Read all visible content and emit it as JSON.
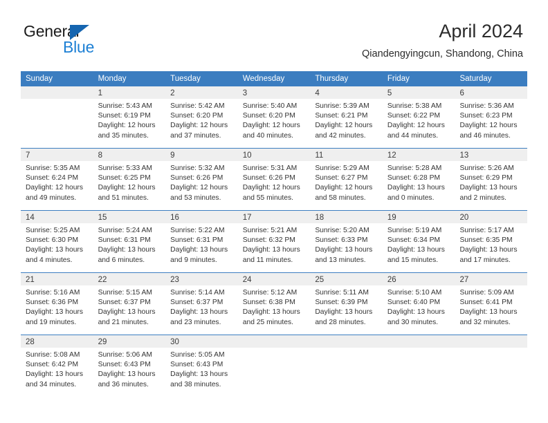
{
  "brand": {
    "name_dark": "General",
    "name_blue": "Blue",
    "accent_blue": "#1c7fd4",
    "triangle_blue": "#1565b0"
  },
  "header": {
    "title": "April 2024",
    "subtitle": "Qiandengyingcun, Shandong, China"
  },
  "calendar": {
    "header_bg": "#3b7dc0",
    "daynum_bg": "#efefef",
    "weekdays": [
      "Sunday",
      "Monday",
      "Tuesday",
      "Wednesday",
      "Thursday",
      "Friday",
      "Saturday"
    ],
    "weeks": [
      [
        {
          "day": "",
          "lines": []
        },
        {
          "day": "1",
          "lines": [
            "Sunrise: 5:43 AM",
            "Sunset: 6:19 PM",
            "Daylight: 12 hours",
            "and 35 minutes."
          ]
        },
        {
          "day": "2",
          "lines": [
            "Sunrise: 5:42 AM",
            "Sunset: 6:20 PM",
            "Daylight: 12 hours",
            "and 37 minutes."
          ]
        },
        {
          "day": "3",
          "lines": [
            "Sunrise: 5:40 AM",
            "Sunset: 6:20 PM",
            "Daylight: 12 hours",
            "and 40 minutes."
          ]
        },
        {
          "day": "4",
          "lines": [
            "Sunrise: 5:39 AM",
            "Sunset: 6:21 PM",
            "Daylight: 12 hours",
            "and 42 minutes."
          ]
        },
        {
          "day": "5",
          "lines": [
            "Sunrise: 5:38 AM",
            "Sunset: 6:22 PM",
            "Daylight: 12 hours",
            "and 44 minutes."
          ]
        },
        {
          "day": "6",
          "lines": [
            "Sunrise: 5:36 AM",
            "Sunset: 6:23 PM",
            "Daylight: 12 hours",
            "and 46 minutes."
          ]
        }
      ],
      [
        {
          "day": "7",
          "lines": [
            "Sunrise: 5:35 AM",
            "Sunset: 6:24 PM",
            "Daylight: 12 hours",
            "and 49 minutes."
          ]
        },
        {
          "day": "8",
          "lines": [
            "Sunrise: 5:33 AM",
            "Sunset: 6:25 PM",
            "Daylight: 12 hours",
            "and 51 minutes."
          ]
        },
        {
          "day": "9",
          "lines": [
            "Sunrise: 5:32 AM",
            "Sunset: 6:26 PM",
            "Daylight: 12 hours",
            "and 53 minutes."
          ]
        },
        {
          "day": "10",
          "lines": [
            "Sunrise: 5:31 AM",
            "Sunset: 6:26 PM",
            "Daylight: 12 hours",
            "and 55 minutes."
          ]
        },
        {
          "day": "11",
          "lines": [
            "Sunrise: 5:29 AM",
            "Sunset: 6:27 PM",
            "Daylight: 12 hours",
            "and 58 minutes."
          ]
        },
        {
          "day": "12",
          "lines": [
            "Sunrise: 5:28 AM",
            "Sunset: 6:28 PM",
            "Daylight: 13 hours",
            "and 0 minutes."
          ]
        },
        {
          "day": "13",
          "lines": [
            "Sunrise: 5:26 AM",
            "Sunset: 6:29 PM",
            "Daylight: 13 hours",
            "and 2 minutes."
          ]
        }
      ],
      [
        {
          "day": "14",
          "lines": [
            "Sunrise: 5:25 AM",
            "Sunset: 6:30 PM",
            "Daylight: 13 hours",
            "and 4 minutes."
          ]
        },
        {
          "day": "15",
          "lines": [
            "Sunrise: 5:24 AM",
            "Sunset: 6:31 PM",
            "Daylight: 13 hours",
            "and 6 minutes."
          ]
        },
        {
          "day": "16",
          "lines": [
            "Sunrise: 5:22 AM",
            "Sunset: 6:31 PM",
            "Daylight: 13 hours",
            "and 9 minutes."
          ]
        },
        {
          "day": "17",
          "lines": [
            "Sunrise: 5:21 AM",
            "Sunset: 6:32 PM",
            "Daylight: 13 hours",
            "and 11 minutes."
          ]
        },
        {
          "day": "18",
          "lines": [
            "Sunrise: 5:20 AM",
            "Sunset: 6:33 PM",
            "Daylight: 13 hours",
            "and 13 minutes."
          ]
        },
        {
          "day": "19",
          "lines": [
            "Sunrise: 5:19 AM",
            "Sunset: 6:34 PM",
            "Daylight: 13 hours",
            "and 15 minutes."
          ]
        },
        {
          "day": "20",
          "lines": [
            "Sunrise: 5:17 AM",
            "Sunset: 6:35 PM",
            "Daylight: 13 hours",
            "and 17 minutes."
          ]
        }
      ],
      [
        {
          "day": "21",
          "lines": [
            "Sunrise: 5:16 AM",
            "Sunset: 6:36 PM",
            "Daylight: 13 hours",
            "and 19 minutes."
          ]
        },
        {
          "day": "22",
          "lines": [
            "Sunrise: 5:15 AM",
            "Sunset: 6:37 PM",
            "Daylight: 13 hours",
            "and 21 minutes."
          ]
        },
        {
          "day": "23",
          "lines": [
            "Sunrise: 5:14 AM",
            "Sunset: 6:37 PM",
            "Daylight: 13 hours",
            "and 23 minutes."
          ]
        },
        {
          "day": "24",
          "lines": [
            "Sunrise: 5:12 AM",
            "Sunset: 6:38 PM",
            "Daylight: 13 hours",
            "and 25 minutes."
          ]
        },
        {
          "day": "25",
          "lines": [
            "Sunrise: 5:11 AM",
            "Sunset: 6:39 PM",
            "Daylight: 13 hours",
            "and 28 minutes."
          ]
        },
        {
          "day": "26",
          "lines": [
            "Sunrise: 5:10 AM",
            "Sunset: 6:40 PM",
            "Daylight: 13 hours",
            "and 30 minutes."
          ]
        },
        {
          "day": "27",
          "lines": [
            "Sunrise: 5:09 AM",
            "Sunset: 6:41 PM",
            "Daylight: 13 hours",
            "and 32 minutes."
          ]
        }
      ],
      [
        {
          "day": "28",
          "lines": [
            "Sunrise: 5:08 AM",
            "Sunset: 6:42 PM",
            "Daylight: 13 hours",
            "and 34 minutes."
          ]
        },
        {
          "day": "29",
          "lines": [
            "Sunrise: 5:06 AM",
            "Sunset: 6:43 PM",
            "Daylight: 13 hours",
            "and 36 minutes."
          ]
        },
        {
          "day": "30",
          "lines": [
            "Sunrise: 5:05 AM",
            "Sunset: 6:43 PM",
            "Daylight: 13 hours",
            "and 38 minutes."
          ]
        },
        {
          "day": "",
          "lines": []
        },
        {
          "day": "",
          "lines": []
        },
        {
          "day": "",
          "lines": []
        },
        {
          "day": "",
          "lines": []
        }
      ]
    ]
  }
}
